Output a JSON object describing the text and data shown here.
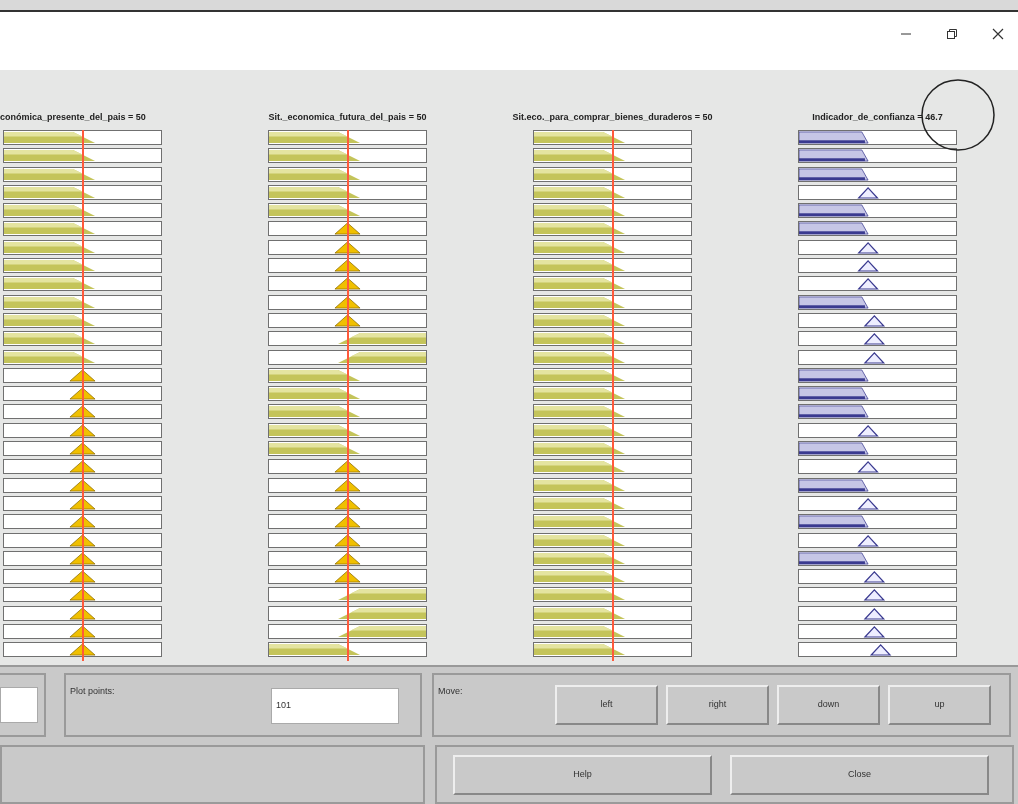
{
  "variables": [
    {
      "label": "conómica_presente_del_pais = 50",
      "kind": "input",
      "level": 0.5
    },
    {
      "label": "Sit._economica_futura_del_pais = 50",
      "kind": "input",
      "level": 0.5
    },
    {
      "label": "Sit.eco._para_comprar_bienes_duraderos = 50",
      "kind": "input",
      "level": 0.5
    },
    {
      "label": "Indicador_de_confianza = 46.7",
      "kind": "output"
    }
  ],
  "rules": [
    {
      "cells": [
        {
          "kind": "left"
        },
        {
          "kind": "left"
        },
        {
          "kind": "left"
        },
        {
          "kind": "low"
        }
      ]
    },
    {
      "cells": [
        {
          "kind": "left"
        },
        {
          "kind": "left"
        },
        {
          "kind": "left"
        },
        {
          "kind": "low"
        }
      ]
    },
    {
      "cells": [
        {
          "kind": "left"
        },
        {
          "kind": "left"
        },
        {
          "kind": "left"
        },
        {
          "kind": "low"
        }
      ]
    },
    {
      "cells": [
        {
          "kind": "left"
        },
        {
          "kind": "left"
        },
        {
          "kind": "left"
        },
        {
          "kind": "mid"
        }
      ]
    },
    {
      "cells": [
        {
          "kind": "left"
        },
        {
          "kind": "left"
        },
        {
          "kind": "left"
        },
        {
          "kind": "low"
        }
      ]
    },
    {
      "cells": [
        {
          "kind": "left"
        },
        {
          "kind": "center"
        },
        {
          "kind": "left"
        },
        {
          "kind": "low"
        }
      ]
    },
    {
      "cells": [
        {
          "kind": "left"
        },
        {
          "kind": "center"
        },
        {
          "kind": "left"
        },
        {
          "kind": "mid"
        }
      ]
    },
    {
      "cells": [
        {
          "kind": "left"
        },
        {
          "kind": "center"
        },
        {
          "kind": "left"
        },
        {
          "kind": "mid"
        }
      ]
    },
    {
      "cells": [
        {
          "kind": "left"
        },
        {
          "kind": "center"
        },
        {
          "kind": "left"
        },
        {
          "kind": "mid"
        }
      ]
    },
    {
      "cells": [
        {
          "kind": "left"
        },
        {
          "kind": "center"
        },
        {
          "kind": "left"
        },
        {
          "kind": "low"
        }
      ]
    },
    {
      "cells": [
        {
          "kind": "left"
        },
        {
          "kind": "center"
        },
        {
          "kind": "left"
        },
        {
          "kind": "midhigh"
        }
      ]
    },
    {
      "cells": [
        {
          "kind": "left"
        },
        {
          "kind": "right"
        },
        {
          "kind": "left"
        },
        {
          "kind": "midhigh"
        }
      ]
    },
    {
      "cells": [
        {
          "kind": "left"
        },
        {
          "kind": "right"
        },
        {
          "kind": "left"
        },
        {
          "kind": "midhigh"
        }
      ]
    },
    {
      "cells": [
        {
          "kind": "center"
        },
        {
          "kind": "left"
        },
        {
          "kind": "left"
        },
        {
          "kind": "low"
        }
      ]
    },
    {
      "cells": [
        {
          "kind": "center"
        },
        {
          "kind": "left"
        },
        {
          "kind": "left"
        },
        {
          "kind": "low"
        }
      ]
    },
    {
      "cells": [
        {
          "kind": "center"
        },
        {
          "kind": "left"
        },
        {
          "kind": "left"
        },
        {
          "kind": "low"
        }
      ]
    },
    {
      "cells": [
        {
          "kind": "center"
        },
        {
          "kind": "left"
        },
        {
          "kind": "left"
        },
        {
          "kind": "mid"
        }
      ]
    },
    {
      "cells": [
        {
          "kind": "center"
        },
        {
          "kind": "left"
        },
        {
          "kind": "left"
        },
        {
          "kind": "low"
        }
      ]
    },
    {
      "cells": [
        {
          "kind": "center"
        },
        {
          "kind": "center"
        },
        {
          "kind": "left"
        },
        {
          "kind": "mid"
        }
      ]
    },
    {
      "cells": [
        {
          "kind": "center"
        },
        {
          "kind": "center"
        },
        {
          "kind": "left"
        },
        {
          "kind": "low"
        }
      ]
    },
    {
      "cells": [
        {
          "kind": "center"
        },
        {
          "kind": "center"
        },
        {
          "kind": "left"
        },
        {
          "kind": "mid"
        }
      ]
    },
    {
      "cells": [
        {
          "kind": "center"
        },
        {
          "kind": "center"
        },
        {
          "kind": "left"
        },
        {
          "kind": "low"
        }
      ]
    },
    {
      "cells": [
        {
          "kind": "center"
        },
        {
          "kind": "center"
        },
        {
          "kind": "left"
        },
        {
          "kind": "mid"
        }
      ]
    },
    {
      "cells": [
        {
          "kind": "center"
        },
        {
          "kind": "center"
        },
        {
          "kind": "left"
        },
        {
          "kind": "low"
        }
      ]
    },
    {
      "cells": [
        {
          "kind": "center"
        },
        {
          "kind": "center"
        },
        {
          "kind": "left"
        },
        {
          "kind": "midhigh"
        }
      ]
    },
    {
      "cells": [
        {
          "kind": "center"
        },
        {
          "kind": "right"
        },
        {
          "kind": "left"
        },
        {
          "kind": "midhigh"
        }
      ]
    },
    {
      "cells": [
        {
          "kind": "center"
        },
        {
          "kind": "right"
        },
        {
          "kind": "left"
        },
        {
          "kind": "midhigh"
        }
      ]
    },
    {
      "cells": [
        {
          "kind": "center"
        },
        {
          "kind": "right"
        },
        {
          "kind": "left"
        },
        {
          "kind": "midhigh"
        }
      ]
    },
    {
      "cells": [
        {
          "kind": "center"
        },
        {
          "kind": "left"
        },
        {
          "kind": "left"
        },
        {
          "kind": "high"
        }
      ]
    }
  ],
  "plot_points": {
    "label": "Plot points:",
    "value": "101"
  },
  "move": {
    "label": "Move:",
    "buttons": [
      "left",
      "right",
      "down",
      "up"
    ]
  },
  "buttons": [
    "Help",
    "Close"
  ]
}
